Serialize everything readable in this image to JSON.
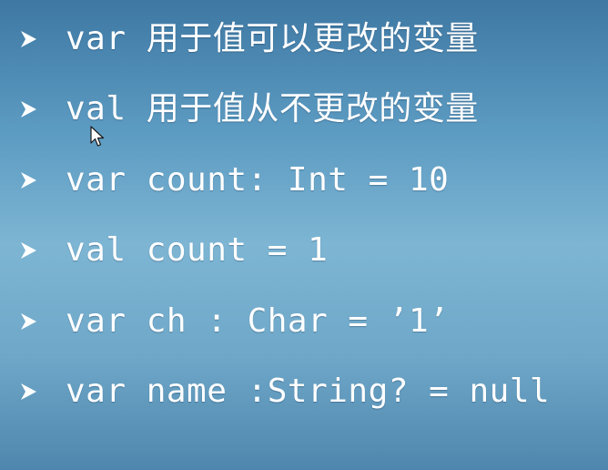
{
  "slide": {
    "bullet_icon": "arrowhead-bullet-icon",
    "text_color": "#ffffff",
    "items": [
      {
        "text": "var 用于值可以更改的变量"
      },
      {
        "text": "val 用于值从不更改的变量"
      },
      {
        "text": "var count: Int = 10"
      },
      {
        "text": "val count = 1"
      },
      {
        "text": "var ch : Char = ’1’"
      },
      {
        "text": "var name :String? = null"
      }
    ]
  },
  "pointer": {
    "icon": "mouse-pointer-icon"
  }
}
